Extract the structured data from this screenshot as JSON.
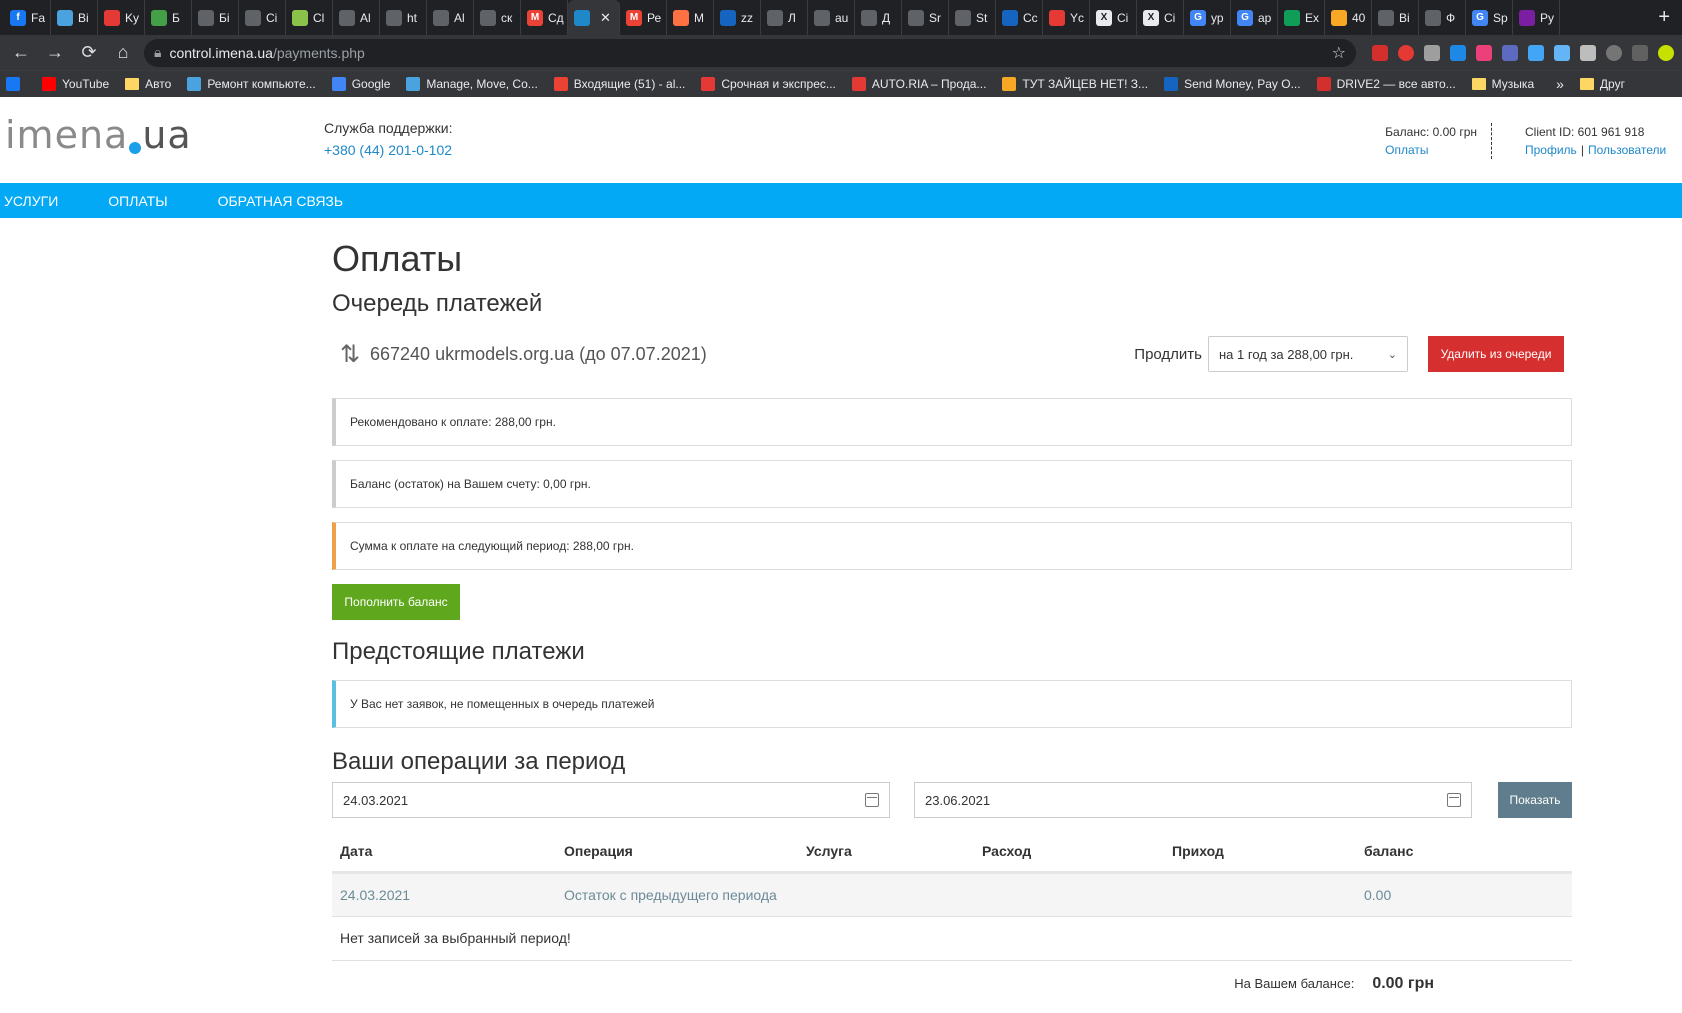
{
  "browser": {
    "tabs": [
      {
        "label": "Fa",
        "color": "#1877f2",
        "glyph": "f"
      },
      {
        "label": "Bi",
        "color": "#4aa3df",
        "glyph": ""
      },
      {
        "label": "Ky",
        "color": "#e53935",
        "glyph": ""
      },
      {
        "label": "Б",
        "color": "#43a047",
        "glyph": ""
      },
      {
        "label": "Бі",
        "color": "#5f6368",
        "glyph": ""
      },
      {
        "label": "Сі",
        "color": "#5f6368",
        "glyph": ""
      },
      {
        "label": "Cl",
        "color": "#8bc34a",
        "glyph": ""
      },
      {
        "label": "Al",
        "color": "#5f6368",
        "glyph": ""
      },
      {
        "label": "ht",
        "color": "#5f6368",
        "glyph": ""
      },
      {
        "label": "Al",
        "color": "#5f6368",
        "glyph": ""
      },
      {
        "label": "ск",
        "color": "#5f6368",
        "glyph": ""
      },
      {
        "label": "Сд",
        "color": "#ea4335",
        "glyph": "M"
      },
      {
        "label": "",
        "color": "#1e88c8",
        "glyph": "",
        "active": true
      },
      {
        "label": "Ре",
        "color": "#ea4335",
        "glyph": "M"
      },
      {
        "label": "М",
        "color": "#ff7043",
        "glyph": ""
      },
      {
        "label": "zz",
        "color": "#1565c0",
        "glyph": ""
      },
      {
        "label": "Л",
        "color": "#5f6368",
        "glyph": ""
      },
      {
        "label": "au",
        "color": "#5f6368",
        "glyph": ""
      },
      {
        "label": "Д",
        "color": "#5f6368",
        "glyph": ""
      },
      {
        "label": "Sr",
        "color": "#5f6368",
        "glyph": ""
      },
      {
        "label": "St",
        "color": "#5f6368",
        "glyph": ""
      },
      {
        "label": "Сс",
        "color": "#1565c0",
        "glyph": ""
      },
      {
        "label": "Yc",
        "color": "#e53935",
        "glyph": ""
      },
      {
        "label": "Сі",
        "color": "#e8eaed",
        "glyph": "X"
      },
      {
        "label": "Сі",
        "color": "#e8eaed",
        "glyph": "X"
      },
      {
        "label": "ур",
        "color": "#4285f4",
        "glyph": "G"
      },
      {
        "label": "ар",
        "color": "#4285f4",
        "glyph": "G"
      },
      {
        "label": "Ex",
        "color": "#0f9d58",
        "glyph": ""
      },
      {
        "label": "40",
        "color": "#f9a825",
        "glyph": ""
      },
      {
        "label": "Ві",
        "color": "#5f6368",
        "glyph": ""
      },
      {
        "label": "Ф",
        "color": "#5f6368",
        "glyph": ""
      },
      {
        "label": "Sp",
        "color": "#4285f4",
        "glyph": "G"
      },
      {
        "label": "Py",
        "color": "#7b1fa2",
        "glyph": ""
      }
    ],
    "url_host": "control.imena.ua",
    "url_path": "/payments.php",
    "bookmarks": [
      {
        "label": "",
        "type": "fav",
        "color": "#1877f2"
      },
      {
        "label": "YouTube",
        "type": "fav",
        "color": "#ff0000"
      },
      {
        "label": "Авто",
        "type": "folder"
      },
      {
        "label": "Ремонт компьюте...",
        "type": "fav",
        "color": "#4aa3df"
      },
      {
        "label": "Google",
        "type": "fav",
        "color": "#4285f4"
      },
      {
        "label": "Manage, Move, Co...",
        "type": "fav",
        "color": "#4aa3df"
      },
      {
        "label": "Входящие (51) - al...",
        "type": "fav",
        "color": "#ea4335"
      },
      {
        "label": "Срочная и экспрес...",
        "type": "fav",
        "color": "#e53935"
      },
      {
        "label": "AUTO.RIA – Прода...",
        "type": "fav",
        "color": "#e53935"
      },
      {
        "label": "ТУТ ЗАЙЦЕВ НЕТ! З...",
        "type": "fav",
        "color": "#f9a825"
      },
      {
        "label": "Send Money, Pay O...",
        "type": "fav",
        "color": "#1565c0"
      },
      {
        "label": "DRIVE2 — все авто...",
        "type": "fav",
        "color": "#d32f2f"
      },
      {
        "label": "Музыка",
        "type": "folder"
      }
    ],
    "bookmarks_more": "»",
    "bookmarks_other": "Друг"
  },
  "header": {
    "logo_left": "imena",
    "logo_right": "ua",
    "support_label": "Служба поддержки:",
    "support_phone": "+380 (44) 201-0-102",
    "balance_text": "Баланс: 0.00 грн",
    "payments_link": "Оплаты",
    "client_id": "Client ID: 601 961 918",
    "profile_link": "Профиль",
    "users_link": "Пользователи"
  },
  "nav": {
    "services": "УСЛУГИ",
    "payments": "ОПЛАТЫ",
    "feedback": "ОБРАТНАЯ СВЯЗЬ"
  },
  "page": {
    "title": "Оплаты",
    "queue_title": "Очередь платежей",
    "queue_item": "667240 ukrmodels.org.ua (до 07.07.2021)",
    "extend_label": "Продлить",
    "extend_option": "на 1 год за 288,00 грн.",
    "remove_button": "Удалить из очереди",
    "alert_recommended": "Рекомендовано к оплате: 288,00 грн.",
    "alert_balance": "Баланс (остаток) на Вашем счету: 0,00 грн.",
    "alert_next": "Сумма к оплате на следующий период: 288,00 грн.",
    "topup_button": "Пополнить баланс",
    "upcoming_title": "Предстоящие платежи",
    "upcoming_alert": "У Вас нет заявок, не помещенных в очередь платежей",
    "ops_title": "Ваши операции за период",
    "date_from": "24.03.2021",
    "date_to": "23.06.2021",
    "show_button": "Показать",
    "table_headers": [
      "Дата",
      "Операция",
      "Услуга",
      "Расход",
      "Приход",
      "баланс"
    ],
    "table_row": [
      "24.03.2021",
      "Остаток с предыдущего периода",
      "",
      "",
      "",
      "0.00"
    ],
    "empty_message": "Нет записей за выбранный период!",
    "total_label": "На Вашем балансе:",
    "total_value": "0.00 грн"
  }
}
